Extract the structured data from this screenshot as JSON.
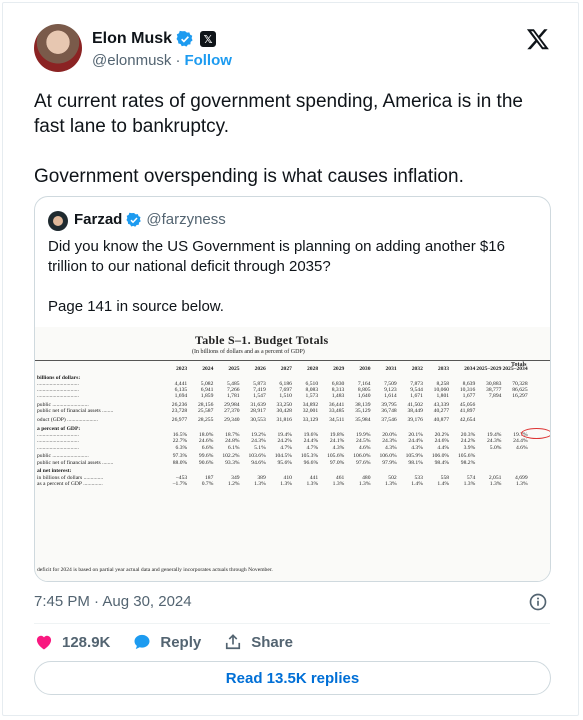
{
  "author": {
    "name": "Elon Musk",
    "handle": "@elonmusk",
    "separator": "·",
    "follow_label": "Follow"
  },
  "tweet": {
    "paragraphs": [
      "At current rates of government spending, America is in the fast lane to bankruptcy.",
      "Government overspending is what causes inflation."
    ]
  },
  "quote": {
    "name": "Farzad",
    "handle": "@farzyness",
    "paragraphs": [
      "Did you know the US Government is planning on adding another $16 trillion to our national deficit through 2035?",
      "Page 141 in source below."
    ],
    "doc": {
      "title": "Table S–1.  Budget Totals",
      "subtitle": "(In billions of dollars and as a percent of GDP)",
      "totals_label": "Totals",
      "years": [
        "2023",
        "2024",
        "2025",
        "2026",
        "2027",
        "2028",
        "2029",
        "2030",
        "2031",
        "2032",
        "2033",
        "2034",
        "2025–2029",
        "2025–2034"
      ],
      "rows": [
        {
          "type": "sec",
          "label": "billions of dollars:",
          "v": []
        },
        {
          "type": "row",
          "label": "..............................",
          "v": [
            "4,441",
            "5,082",
            "5,485",
            "5,873",
            "6,186",
            "6,510",
            "6,830",
            "7,164",
            "7,509",
            "7,873",
            "8,258",
            "8,639",
            "30,883",
            "70,328"
          ]
        },
        {
          "type": "row",
          "label": "..............................",
          "v": [
            "6,135",
            "6,941",
            "7,266",
            "7,419",
            "7,697",
            "8,083",
            "8,313",
            "8,805",
            "9,123",
            "9,544",
            "10,060",
            "10,316",
            "38,777",
            "86,625"
          ]
        },
        {
          "type": "row",
          "label": "..............................",
          "v": [
            "1,694",
            "1,859",
            "1,781",
            "1,547",
            "1,510",
            "1,573",
            "1,483",
            "1,640",
            "1,614",
            "1,671",
            "1,801",
            "1,677",
            "7,894",
            "16,297"
          ]
        },
        {
          "type": "gap",
          "label": "",
          "v": []
        },
        {
          "type": "row",
          "label": "public ..........................",
          "v": [
            "26,236",
            "28,156",
            "29,984",
            "31,639",
            "33,250",
            "34,892",
            "36,441",
            "38,139",
            "39,795",
            "41,502",
            "43,339",
            "45,056",
            "",
            ""
          ]
        },
        {
          "type": "row",
          "label": "public net of financial assets ........",
          "v": [
            "23,728",
            "25,587",
            "27,370",
            "28,917",
            "30,428",
            "32,001",
            "33,485",
            "35,129",
            "36,748",
            "38,449",
            "40,277",
            "41,897",
            "",
            ""
          ]
        },
        {
          "type": "gap",
          "label": "",
          "v": []
        },
        {
          "type": "row",
          "label": "oduct (GDP) ......................",
          "v": [
            "26,977",
            "28,255",
            "29,340",
            "30,553",
            "31,816",
            "33,129",
            "34,511",
            "35,984",
            "37,546",
            "39,176",
            "40,877",
            "42,654",
            "",
            ""
          ]
        },
        {
          "type": "gap",
          "label": "",
          "v": []
        },
        {
          "type": "sec",
          "label": "a percent of GDP:",
          "v": []
        },
        {
          "type": "row",
          "label": "..............................",
          "v": [
            "16.5%",
            "18.0%",
            "18.7%",
            "19.2%",
            "19.4%",
            "19.6%",
            "19.8%",
            "19.9%",
            "20.0%",
            "20.1%",
            "20.2%",
            "20.3%",
            "19.4%",
            "19.7%"
          ]
        },
        {
          "type": "row",
          "label": "..............................",
          "v": [
            "22.7%",
            "24.6%",
            "24.8%",
            "24.3%",
            "24.2%",
            "24.4%",
            "24.1%",
            "24.5%",
            "24.3%",
            "24.4%",
            "24.6%",
            "24.2%",
            "24.3%",
            "24.4%"
          ]
        },
        {
          "type": "row",
          "label": "..............................",
          "v": [
            "6.3%",
            "6.6%",
            "6.1%",
            "5.1%",
            "4.7%",
            "4.7%",
            "4.3%",
            "4.6%",
            "4.3%",
            "4.3%",
            "4.4%",
            "3.9%",
            "5.0%",
            "4.6%"
          ]
        },
        {
          "type": "gap",
          "label": "",
          "v": []
        },
        {
          "type": "row",
          "label": "public ..........................",
          "v": [
            "97.3%",
            "99.6%",
            "102.2%",
            "103.6%",
            "104.5%",
            "105.3%",
            "105.6%",
            "106.0%",
            "106.0%",
            "105.9%",
            "106.0%",
            "105.6%",
            "",
            ""
          ]
        },
        {
          "type": "row",
          "label": "public net of financial assets ........",
          "v": [
            "88.0%",
            "90.6%",
            "93.3%",
            "94.6%",
            "95.6%",
            "96.6%",
            "97.0%",
            "97.6%",
            "97.9%",
            "98.1%",
            "98.4%",
            "98.2%",
            "",
            ""
          ]
        },
        {
          "type": "gap",
          "label": "",
          "v": []
        },
        {
          "type": "sec",
          "label": "al net interest:",
          "v": []
        },
        {
          "type": "row",
          "label": "in billions of dollars ..............",
          "v": [
            "–453",
            "187",
            "349",
            "389",
            "410",
            "441",
            "461",
            "480",
            "502",
            "533",
            "558",
            "574",
            "2,051",
            "4,699"
          ]
        },
        {
          "type": "row",
          "label": "as a percent of GDP ..............",
          "v": [
            "–1.7%",
            "0.7%",
            "1.2%",
            "1.3%",
            "1.3%",
            "1.3%",
            "1.3%",
            "1.3%",
            "1.3%",
            "1.4%",
            "1.4%",
            "1.3%",
            "1.3%",
            "1.3%"
          ]
        }
      ],
      "footnote": "deficit for 2024 is based on partial year actual data and generally incorporates actuals through November."
    }
  },
  "timestamp": "7:45 PM · Aug 30, 2024",
  "actions": {
    "likes": "128.9K",
    "reply_label": "Reply",
    "share_label": "Share"
  },
  "read_replies_label": "Read 13.5K replies",
  "colors": {
    "like": "#f91880",
    "reply": "#1d9bf0",
    "link": "#006fd6",
    "circle": "#dd3333"
  }
}
